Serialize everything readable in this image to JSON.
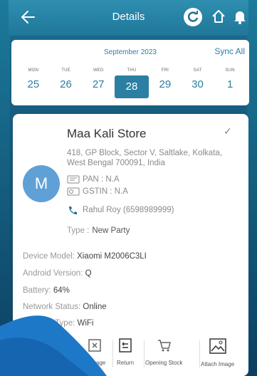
{
  "header": {
    "title": "Details",
    "back_icon": "arrow-left-icon",
    "sync_icon": "refresh-icon",
    "home_icon": "home-icon",
    "bell_icon": "bell-icon"
  },
  "calendar": {
    "month": "September 2023",
    "sync_all": "Sync All",
    "days": [
      {
        "name": "MON",
        "num": "25"
      },
      {
        "name": "TUE",
        "num": "26"
      },
      {
        "name": "WED",
        "num": "27"
      },
      {
        "name": "THU",
        "num": "28",
        "selected": true
      },
      {
        "name": "FRI",
        "num": "29"
      },
      {
        "name": "SAT",
        "num": "30"
      },
      {
        "name": "SUN",
        "num": "1"
      }
    ]
  },
  "store": {
    "name": "Maa Kali Store",
    "address": "418, GP Block, Sector V, Saltlake, Kolkata, West Bengal 700091, India",
    "avatar_letter": "M",
    "pan": "PAN : N.A",
    "gstin": "GSTIN : N.A",
    "contact": "Rahul Roy (6598989999)",
    "type_label": "Type :",
    "type_value": "New Party"
  },
  "device": {
    "model_label": "Device Model:",
    "model": "Xiaomi M2006C3LI",
    "android_label": "Android Version:",
    "android": "Q",
    "battery_label": "Battery:",
    "battery": "64%",
    "network_status_label": "Network Status:",
    "network_status": "Online",
    "network_type_label": "Network Type:",
    "network_type": "WiFi"
  },
  "actions": {
    "damage": "Damage",
    "return": "Return",
    "opening_stock": "Opening Stock",
    "attach_image": "Attach Image"
  },
  "colors": {
    "accent": "#2a7fa3",
    "header": "#2f8fb1",
    "avatar": "#5fa0d6"
  }
}
